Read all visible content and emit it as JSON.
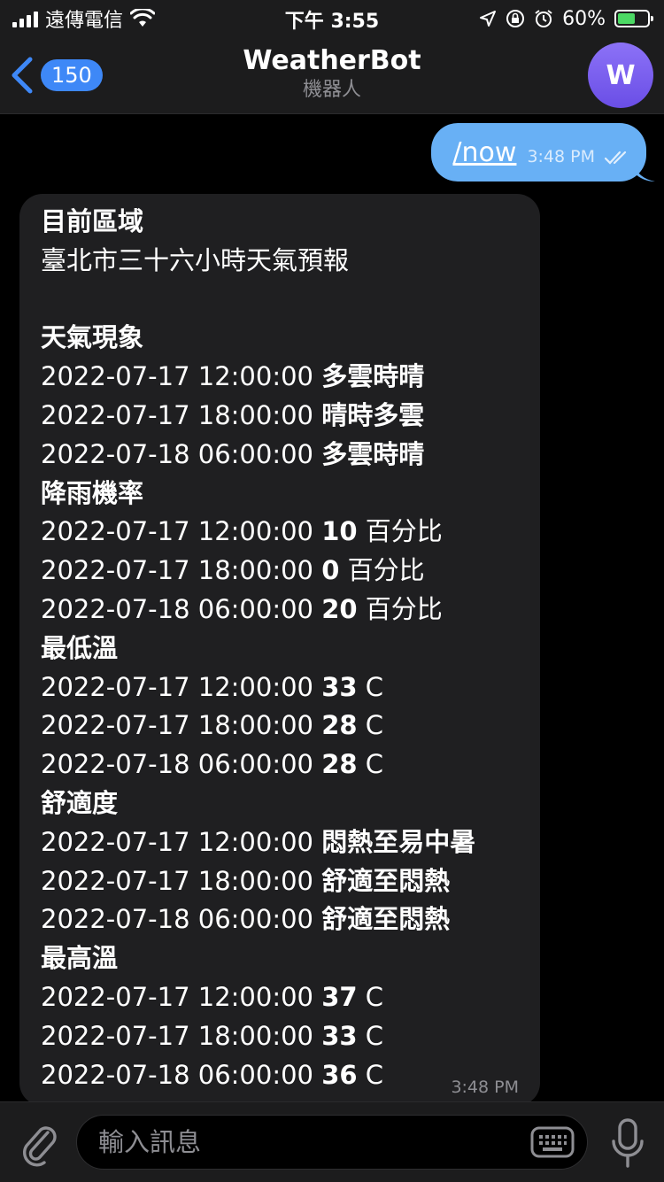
{
  "status_bar": {
    "carrier": "遠傳電信",
    "time": "下午 3:55",
    "battery_percent": "60%",
    "battery_level": 0.6
  },
  "header": {
    "back_count": "150",
    "title": "WeatherBot",
    "subtitle": "機器人",
    "avatar_initial": "W",
    "avatar_color": "#7b5ff0"
  },
  "messages": {
    "outgoing": {
      "text": "/now",
      "time": "3:48 PM",
      "status": "read"
    },
    "incoming": {
      "time": "3:48 PM",
      "lines": [
        {
          "text": "目前區域",
          "bold": true
        },
        {
          "text": "臺北市三十六小時天氣預報"
        },
        {
          "text": ""
        },
        {
          "text": "天氣現象",
          "bold": true
        },
        {
          "text": "2022-07-17 12:00:00",
          "value": "多雲時晴"
        },
        {
          "text": "2022-07-17 18:00:00",
          "value": "晴時多雲"
        },
        {
          "text": "2022-07-18 06:00:00",
          "value": "多雲時晴"
        },
        {
          "text": "降雨機率",
          "bold": true
        },
        {
          "text": "2022-07-17 12:00:00",
          "value": "10",
          "suffix": "百分比"
        },
        {
          "text": "2022-07-17 18:00:00",
          "value": "0",
          "suffix": "百分比"
        },
        {
          "text": "2022-07-18 06:00:00",
          "value": "20",
          "suffix": "百分比"
        },
        {
          "text": "最低溫",
          "bold": true
        },
        {
          "text": "2022-07-17 12:00:00",
          "value": "33",
          "suffix": "C"
        },
        {
          "text": "2022-07-17 18:00:00",
          "value": "28",
          "suffix": "C"
        },
        {
          "text": "2022-07-18 06:00:00",
          "value": "28",
          "suffix": "C"
        },
        {
          "text": "舒適度",
          "bold": true
        },
        {
          "text": "2022-07-17 12:00:00",
          "value": "悶熱至易中暑"
        },
        {
          "text": "2022-07-17 18:00:00",
          "value": "舒適至悶熱"
        },
        {
          "text": "2022-07-18 06:00:00",
          "value": "舒適至悶熱"
        },
        {
          "text": "最高溫",
          "bold": true
        },
        {
          "text": "2022-07-17 12:00:00",
          "value": "37",
          "suffix": "C"
        },
        {
          "text": "2022-07-17 18:00:00",
          "value": "33",
          "suffix": "C"
        },
        {
          "text": "2022-07-18 06:00:00",
          "value": "36",
          "suffix": "C"
        }
      ]
    }
  },
  "input": {
    "placeholder": "輸入訊息"
  },
  "icons": {
    "back": "chevron-left-icon",
    "attach": "paperclip-icon",
    "keyboard": "keyboard-icon",
    "mic": "microphone-icon",
    "read_receipt": "double-check-icon"
  },
  "colors": {
    "accent": "#3e88f7",
    "outgoing_bubble": "#68b0f5",
    "incoming_bubble": "#1f1f21",
    "battery_fill": "#4cd964"
  }
}
